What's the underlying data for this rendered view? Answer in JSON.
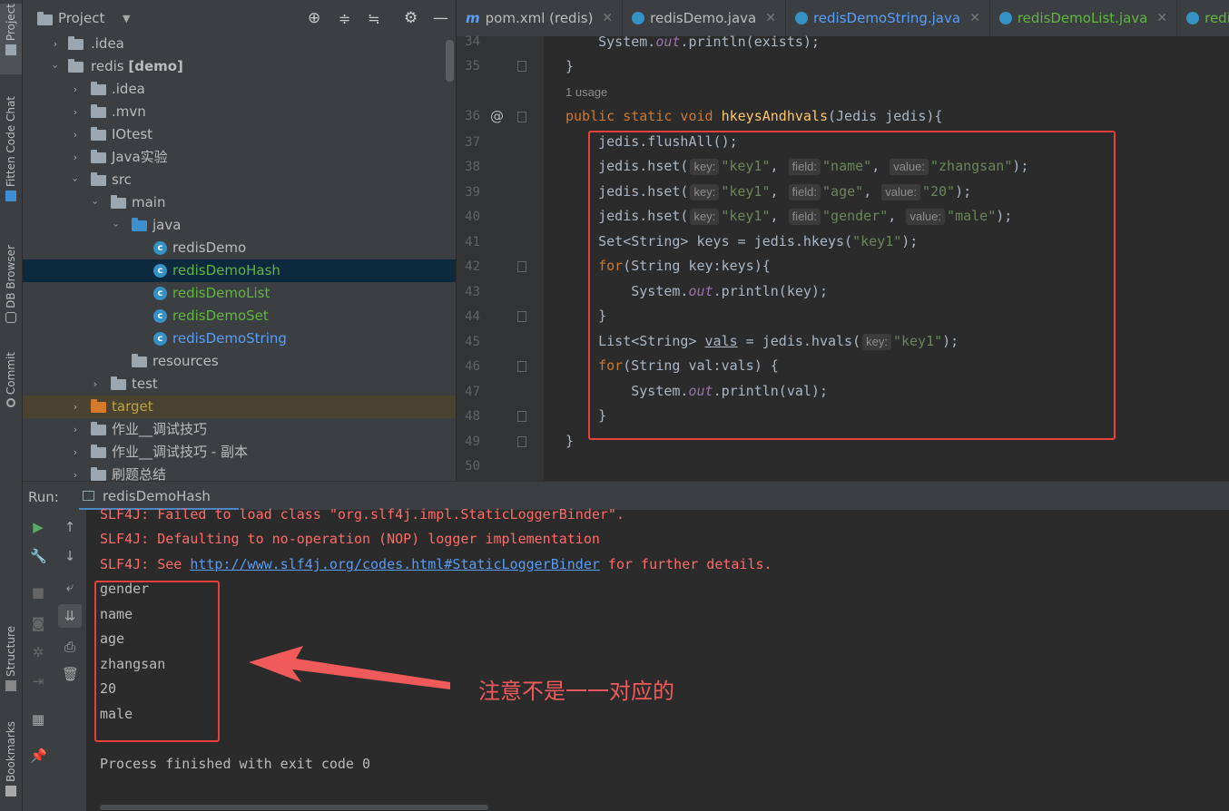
{
  "side_tabs": {
    "project": "Project",
    "fitten": "Fitten Code Chat",
    "db": "DB Browser",
    "commit": "Commit",
    "structure": "Structure",
    "bookmarks": "Bookmarks"
  },
  "project": {
    "title": "Project",
    "tree": [
      {
        "label": ".idea"
      },
      {
        "label": "redis",
        "bold": "[demo]"
      },
      {
        "label": ".idea"
      },
      {
        "label": ".mvn"
      },
      {
        "label": "IOtest"
      },
      {
        "label": "Java实验"
      },
      {
        "label": "src"
      },
      {
        "label": "main"
      },
      {
        "label": "java"
      },
      {
        "label": "redisDemo"
      },
      {
        "label": "redisDemoHash"
      },
      {
        "label": "redisDemoList"
      },
      {
        "label": "redisDemoSet"
      },
      {
        "label": "redisDemoString"
      },
      {
        "label": "resources"
      },
      {
        "label": "test"
      },
      {
        "label": "target"
      },
      {
        "label": "作业__调试技巧"
      },
      {
        "label": "作业__调试技巧 - 副本"
      },
      {
        "label": "刷题总结"
      }
    ]
  },
  "tabs": [
    {
      "label": "pom.xml (redis)",
      "prefix": "m"
    },
    {
      "label": "redisDemo.java"
    },
    {
      "label": "redisDemoString.java"
    },
    {
      "label": "redisDemoList.java"
    },
    {
      "label": "redisD"
    }
  ],
  "editor": {
    "line_numbers": [
      "34",
      "35",
      "36",
      "37",
      "38",
      "39",
      "40",
      "41",
      "42",
      "43",
      "44",
      "45",
      "46",
      "47",
      "48",
      "49",
      "50"
    ],
    "usage": "1 usage",
    "code": {
      "l34a": "    System.",
      "l34b": "out",
      "l34c": ".println(exists);",
      "l35": "}",
      "l36kw": "public static void ",
      "l36fn": "hkeysAndhvals",
      "l36rest": "(Jedis jedis){",
      "l37": "    jedis.flushAll();",
      "hset": "    jedis.hset(",
      "hint_key": "key:",
      "hint_field": "field:",
      "hint_value": "value:",
      "s_key1": "\"key1\"",
      "comma": ", ",
      "s_name": "\"name\"",
      "s_zhangsan": "\"zhangsan\"",
      "s_age": "\"age\"",
      "s_20": "\"20\"",
      "s_gender": "\"gender\"",
      "s_male": "\"male\"",
      "close": ");",
      "l41a": "    Set<String> keys = jedis.hkeys(",
      "l41b": ");",
      "for": "for",
      "l42b": "(String key:keys){",
      "l43a": "        System.",
      "l43b": "out",
      "l43c": ".println(key);",
      "l44": "    }",
      "l45a": "    List<String> ",
      "l45b": "vals",
      "l45c": " = jedis.hvals(",
      "l45d": ");",
      "l46b": "(String val:vals) {",
      "l47c": ".println(val);",
      "l48": "    }",
      "l49": "}"
    }
  },
  "run": {
    "label": "Run:",
    "tab": "redisDemoHash",
    "lines": {
      "e1": "SLF4J: Failed to load class \"org.slf4j.impl.StaticLoggerBinder\".",
      "e2": "SLF4J: Defaulting to no-operation (NOP) logger implementation",
      "e3a": "SLF4J: See ",
      "e3link": "http://www.slf4j.org/codes.html#StaticLoggerBinder",
      "e3b": " for further details.",
      "outputs": [
        "gender",
        "name",
        "age",
        "zhangsan",
        "20",
        "male"
      ],
      "exit": "Process finished with exit code 0"
    }
  },
  "annotation": {
    "note": "注意不是一一对应的",
    "color": "#e8413a"
  }
}
